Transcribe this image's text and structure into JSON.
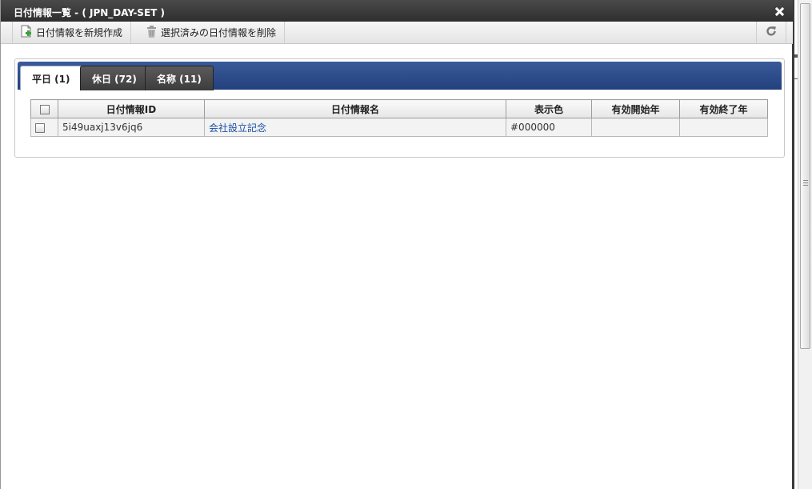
{
  "dialog": {
    "title": "日付情報一覧 - ( JPN_DAY-SET )",
    "close_icon": "close-icon"
  },
  "toolbar": {
    "new_label": "日付情報を新規作成",
    "delete_label": "選択済みの日付情報を削除",
    "icons": [
      "new-document-icon",
      "trash-icon",
      "refresh-icon"
    ]
  },
  "tabs": [
    {
      "label": "平日 (1)",
      "active": true
    },
    {
      "label": "休日 (72)",
      "active": false
    },
    {
      "label": "名称 (11)",
      "active": false
    }
  ],
  "table": {
    "headers": [
      "日付情報ID",
      "日付情報名",
      "表示色",
      "有効開始年",
      "有効終了年"
    ],
    "rows": [
      {
        "id": "5i49uaxj13v6jq6",
        "name": "会社設立記念",
        "color": "#000000",
        "start_year": "",
        "end_year": ""
      }
    ]
  },
  "colors": {
    "titlebar": "#2f2f2f",
    "tabbar": "#22407d",
    "link": "#1a4fa3"
  }
}
